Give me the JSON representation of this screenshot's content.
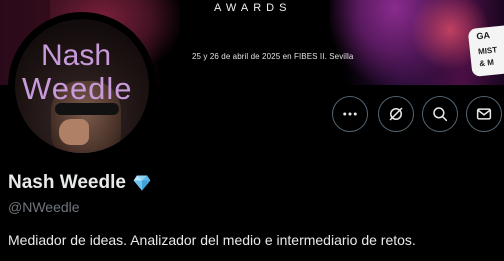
{
  "banner": {
    "awards_text": "AWARDS",
    "event_text": "25 y 26 de abril de 2025 en FIBES II. Sevilla",
    "sponsor_line1": "GA",
    "sponsor_line2": "MIST",
    "sponsor_line3": "& M"
  },
  "avatar": {
    "text_line1": "Nash",
    "text_line2": "Weedle"
  },
  "actions": {
    "more_label": "More",
    "grok_label": "Grok",
    "search_label": "Search",
    "message_label": "Message"
  },
  "profile": {
    "display_name": "Nash Weedle",
    "badge_icon": "gem-icon",
    "handle": "@NWeedle",
    "bio": "Mediador de ideas. Analizador del medio e intermediario de retos."
  },
  "colors": {
    "background": "#000000",
    "text_primary": "#e7e9ea",
    "text_secondary": "#71767b",
    "button_border": "#536471",
    "avatar_text": "#c79ad9"
  }
}
